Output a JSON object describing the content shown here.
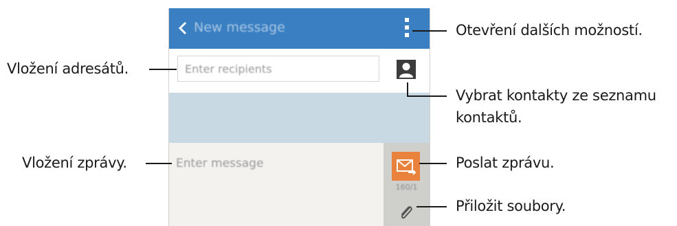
{
  "phone": {
    "header": {
      "title": "New message"
    },
    "recipients": {
      "placeholder": "Enter recipients"
    },
    "message": {
      "placeholder": "Enter message",
      "counter": "160/1"
    }
  },
  "callouts": {
    "more_options": "Otevření dalších možností.",
    "add_recipients": "Vložení adresátů.",
    "pick_contacts_line1": "Vybrat kontakty ze seznamu",
    "pick_contacts_line2": "kontaktů.",
    "enter_message": "Vložení zprávy.",
    "send_message": "Poslat zprávu.",
    "attach_files": "Přiložit soubory."
  },
  "colors": {
    "header": "#3a7fc2",
    "send_button": "#e8823d",
    "conversation_area": "#c8d9e4"
  },
  "icons": [
    "back-icon",
    "more-options-icon",
    "contact-icon",
    "send-icon",
    "attach-icon"
  ]
}
